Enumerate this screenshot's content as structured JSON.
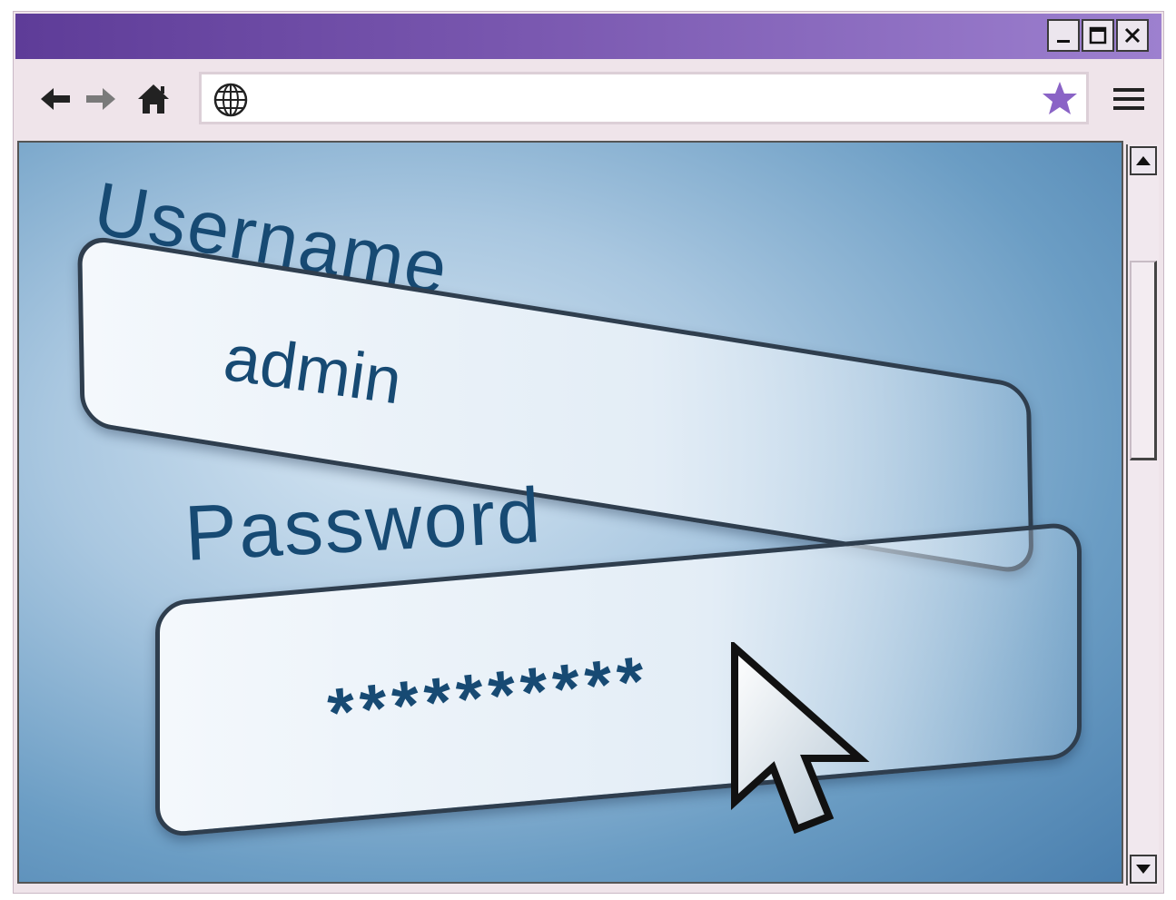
{
  "window": {
    "controls": [
      "minimize-icon",
      "maximize-icon",
      "close-icon"
    ]
  },
  "navbar": {
    "icons": [
      "back-arrow-icon",
      "forward-arrow-icon",
      "home-icon",
      "menu-icon"
    ]
  },
  "address": {
    "value": "",
    "left_icon": "globe-icon",
    "right_icon": "bookmark-star-icon",
    "star_color": "#8a63c6"
  },
  "login": {
    "username_label": "Username",
    "username_value": "admin",
    "password_label": "Password",
    "password_value": "**********"
  },
  "colors": {
    "titlebar_start": "#5e3c98",
    "titlebar_end": "#9d80cf",
    "label_text": "#174a73"
  }
}
